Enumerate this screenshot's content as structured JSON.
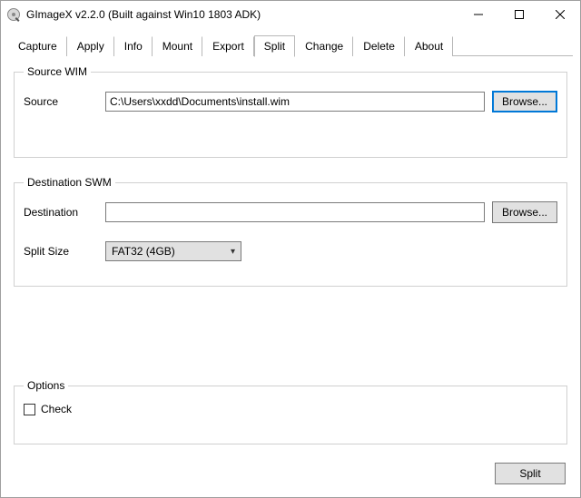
{
  "window": {
    "title": "GImageX v2.2.0 (Built against Win10 1803 ADK)"
  },
  "tabs": {
    "items": [
      "Capture",
      "Apply",
      "Info",
      "Mount",
      "Export",
      "Split",
      "Change",
      "Delete",
      "About"
    ],
    "active_index": 5
  },
  "groups": {
    "source": {
      "legend": "Source WIM",
      "source_label": "Source",
      "source_value": "C:\\Users\\xxdd\\Documents\\install.wim",
      "browse_label": "Browse..."
    },
    "dest": {
      "legend": "Destination SWM",
      "destination_label": "Destination",
      "destination_value": "",
      "browse_label": "Browse...",
      "split_size_label": "Split Size",
      "split_size_value": "FAT32 (4GB)"
    },
    "options": {
      "legend": "Options",
      "check_label": "Check",
      "check_checked": false
    }
  },
  "footer": {
    "split_label": "Split"
  }
}
